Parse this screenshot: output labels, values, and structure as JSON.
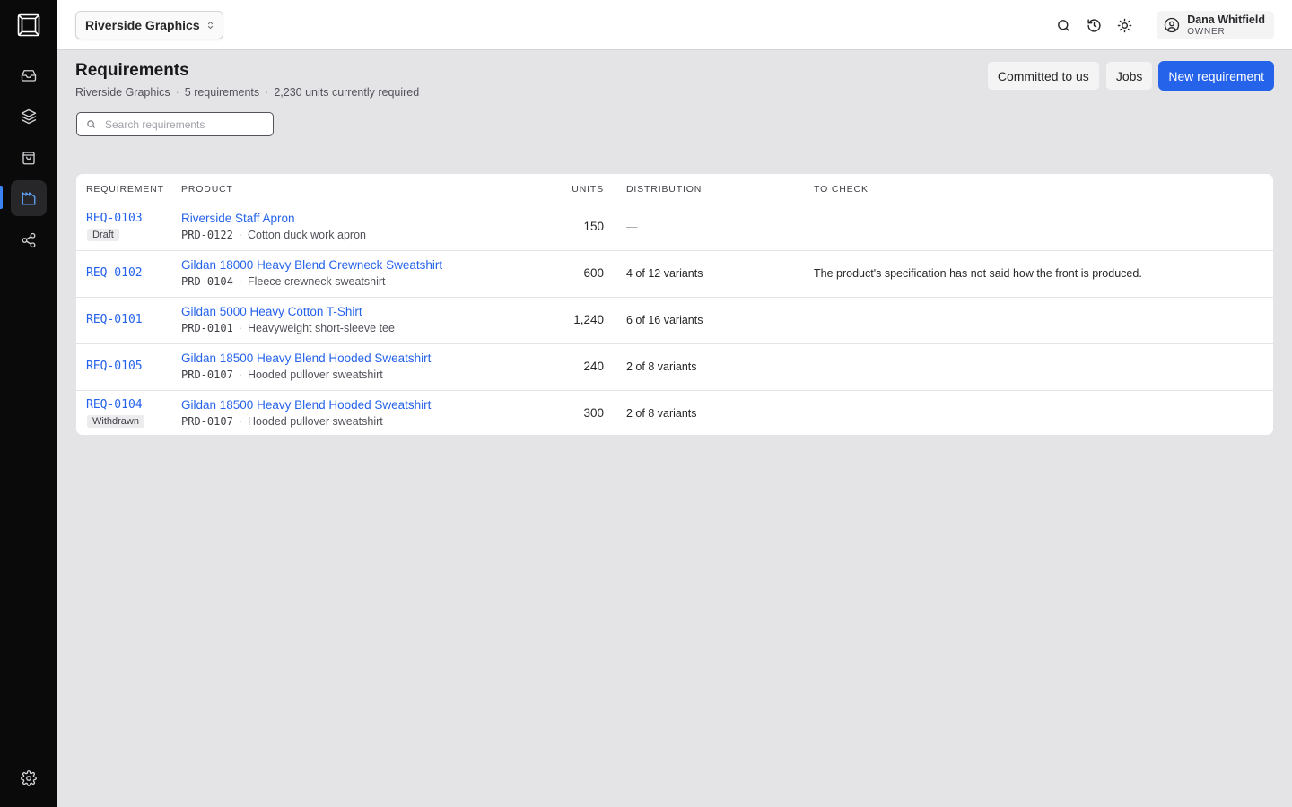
{
  "app": {
    "nav": [
      {
        "name": "inbox-icon"
      },
      {
        "name": "layers-icon"
      },
      {
        "name": "shopping-bag-icon"
      },
      {
        "name": "factory-icon"
      },
      {
        "name": "share-icon"
      }
    ],
    "settings_icon": "gear-icon",
    "accent": "#2563eb"
  },
  "topbar": {
    "org": "Riverside Graphics",
    "user": {
      "name": "Dana Whitfield",
      "role": "OWNER"
    }
  },
  "page": {
    "title": "Requirements",
    "subtitle": {
      "org": "Riverside Graphics",
      "count": "5 requirements",
      "units": "2,230 units currently required"
    },
    "actions": {
      "committed": "Committed to us",
      "jobs": "Jobs",
      "new": "New requirement"
    },
    "search": {
      "placeholder": "Search requirements",
      "value": ""
    }
  },
  "table": {
    "headers": {
      "requirement": "REQUIREMENT",
      "product": "PRODUCT",
      "units": "UNITS",
      "distribution": "DISTRIBUTION",
      "to_check": "TO CHECK"
    },
    "rows": [
      {
        "id": "REQ-0103",
        "badge": "Draft",
        "product": "Riverside Staff Apron",
        "code": "PRD-0122",
        "desc": "Cotton duck work apron",
        "units": "150",
        "distribution": "—",
        "to_check": ""
      },
      {
        "id": "REQ-0102",
        "badge": "",
        "product": "Gildan 18000 Heavy Blend Crewneck Sweatshirt",
        "code": "PRD-0104",
        "desc": "Fleece crewneck sweatshirt",
        "units": "600",
        "distribution": "4 of 12 variants",
        "to_check": "The product's specification has not said how the front is produced."
      },
      {
        "id": "REQ-0101",
        "badge": "",
        "product": "Gildan 5000 Heavy Cotton T-Shirt",
        "code": "PRD-0101",
        "desc": "Heavyweight short-sleeve tee",
        "units": "1,240",
        "distribution": "6 of 16 variants",
        "to_check": ""
      },
      {
        "id": "REQ-0105",
        "badge": "",
        "product": "Gildan 18500 Heavy Blend Hooded Sweatshirt",
        "code": "PRD-0107",
        "desc": "Hooded pullover sweatshirt",
        "units": "240",
        "distribution": "2 of 8 variants",
        "to_check": ""
      },
      {
        "id": "REQ-0104",
        "badge": "Withdrawn",
        "product": "Gildan 18500 Heavy Blend Hooded Sweatshirt",
        "code": "PRD-0107",
        "desc": "Hooded pullover sweatshirt",
        "units": "300",
        "distribution": "2 of 8 variants",
        "to_check": ""
      }
    ]
  }
}
